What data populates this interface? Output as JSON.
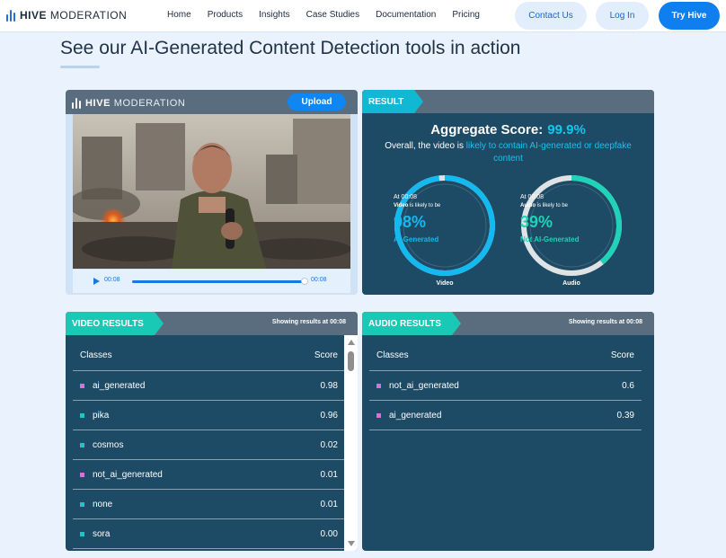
{
  "nav": {
    "logo_bold": "HIVE",
    "logo_rest": "MODERATION",
    "links": [
      "Home",
      "Products",
      "Insights",
      "Case Studies",
      "Documentation",
      "Pricing"
    ],
    "contact_label": "Contact Us",
    "login_label": "Log In",
    "try_label": "Try Hive"
  },
  "heading": "See our AI-Generated Content Detection tools in action",
  "video": {
    "logo_bold": "HIVE",
    "logo_rest": "MODERATION",
    "upload_label": "Upload",
    "current_time": "00:08",
    "duration": "00:08",
    "progress": 1.0
  },
  "result": {
    "tag": "RESULT",
    "aggregate_label": "Aggregate Score:",
    "aggregate_value": "99.9%",
    "overall_prefix": "Overall, the video is ",
    "overall_highlight": "likely to contain AI-generated or deepfake content",
    "gauges": [
      {
        "at": "At 00:08",
        "subject": "Video",
        "likely": " is likely to be",
        "pct": "98%",
        "fraction": 0.98,
        "label": "AI-Generated",
        "name": "Video",
        "color": "#13b9ef"
      },
      {
        "at": "At 00:08",
        "subject": "Audio",
        "likely": " is likely to be",
        "pct": "39%",
        "fraction": 0.39,
        "label": "Not AI-Generated",
        "name": "Audio",
        "color": "#1fd2b8"
      }
    ]
  },
  "video_results": {
    "tag": "VIDEO RESULTS",
    "showing": "Showing results at 00:08",
    "col_classes": "Classes",
    "col_score": "Score",
    "rows": [
      {
        "cls": "ai_generated",
        "score": "0.98",
        "color": "#e06bd9"
      },
      {
        "cls": "pika",
        "score": "0.96",
        "color": "#19c9c4"
      },
      {
        "cls": "cosmos",
        "score": "0.02",
        "color": "#19c9c4"
      },
      {
        "cls": "not_ai_generated",
        "score": "0.01",
        "color": "#e06bd9"
      },
      {
        "cls": "none",
        "score": "0.01",
        "color": "#19c9c4"
      },
      {
        "cls": "sora",
        "score": "0.00",
        "color": "#19c9c4"
      }
    ]
  },
  "audio_results": {
    "tag": "AUDIO RESULTS",
    "showing": "Showing results at 00:08",
    "col_classes": "Classes",
    "col_score": "Score",
    "rows": [
      {
        "cls": "not_ai_generated",
        "score": "0.6",
        "color": "#e06bd9"
      },
      {
        "cls": "ai_generated",
        "score": "0.39",
        "color": "#e06bd9"
      }
    ]
  }
}
